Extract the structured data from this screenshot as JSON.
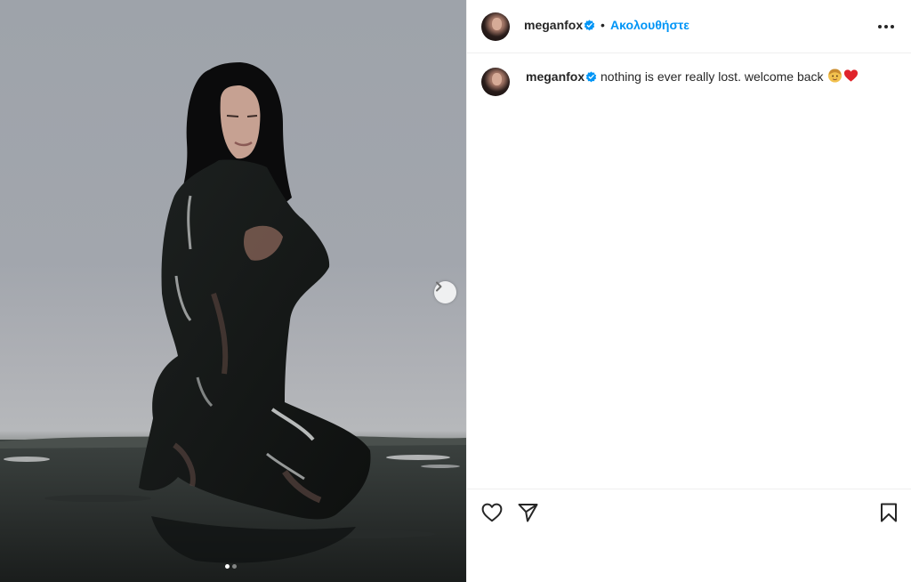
{
  "post": {
    "image_alt": "Woman with long dark hair kneeling in dark water, covered in black paint",
    "carousel": {
      "count": 2,
      "active_index": 0
    }
  },
  "header": {
    "username": "meganfox",
    "separator": "•",
    "follow_label": "Ακολουθήστε",
    "more_icon": "more-horizontal-icon"
  },
  "caption": {
    "username": "meganfox",
    "text": "nothing is ever really lost. welcome back",
    "emojis": [
      "woman-face-emoji",
      "red-heart-emoji"
    ]
  },
  "actions": {
    "like_icon": "heart-icon",
    "share_icon": "send-icon",
    "save_icon": "bookmark-icon"
  },
  "colors": {
    "link": "#0095f6",
    "verified": "#0095f6",
    "text": "#262626",
    "divider": "#efefef"
  }
}
